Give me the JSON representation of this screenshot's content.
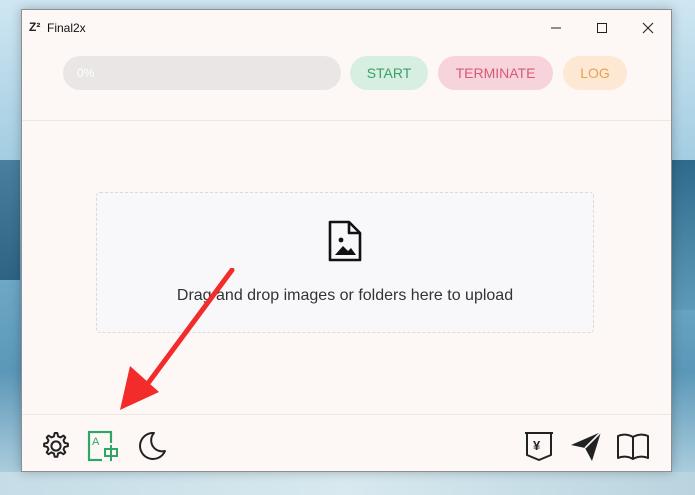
{
  "window": {
    "app_icon_glyph": "Z²",
    "title": "Final2x",
    "minimize_glyph": "—",
    "maximize_glyph": "☐",
    "close_glyph": "✕"
  },
  "toolbar": {
    "progress_text": "0%",
    "progress_value": 0,
    "start_label": "START",
    "terminate_label": "TERMINATE",
    "log_label": "LOG"
  },
  "dropzone": {
    "icon": "image-file-icon",
    "text": "Drag and drop images or folders here to upload"
  },
  "bottom_bar": {
    "left_icons": [
      "settings-icon",
      "translate-icon",
      "moon-icon"
    ],
    "right_icons": [
      "donate-yen-icon",
      "send-icon",
      "book-icon"
    ]
  },
  "colors": {
    "start_bg": "#d7efe0",
    "start_text": "#3aa06a",
    "terminate_bg": "#f7d4dc",
    "terminate_text": "#d65a74",
    "log_bg": "#fde8d3",
    "log_text": "#e6a256",
    "accent_green": "#2fa566",
    "annotation_red": "#f22b2b"
  }
}
